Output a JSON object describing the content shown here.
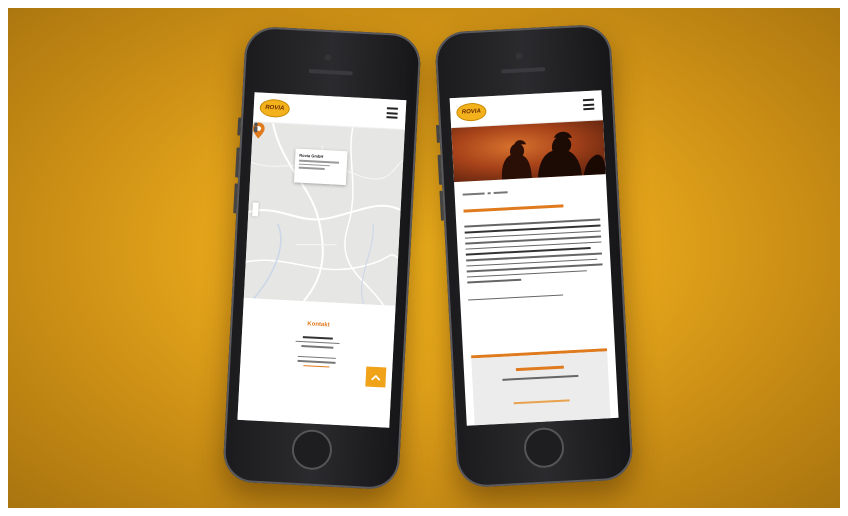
{
  "brand": {
    "logo_text": "ROVIA"
  },
  "left_screen": {
    "map_popup_title": "Rovia GmbH",
    "section_title": "Kontakt"
  },
  "colors": {
    "background": "#e3a31a",
    "accent": "#e07a1e",
    "scroll_top_button": "#f0a219"
  },
  "icons": {
    "menu": "hamburger-icon",
    "map_marker": "map-pin-icon",
    "scroll_top": "chevron-up-icon"
  }
}
